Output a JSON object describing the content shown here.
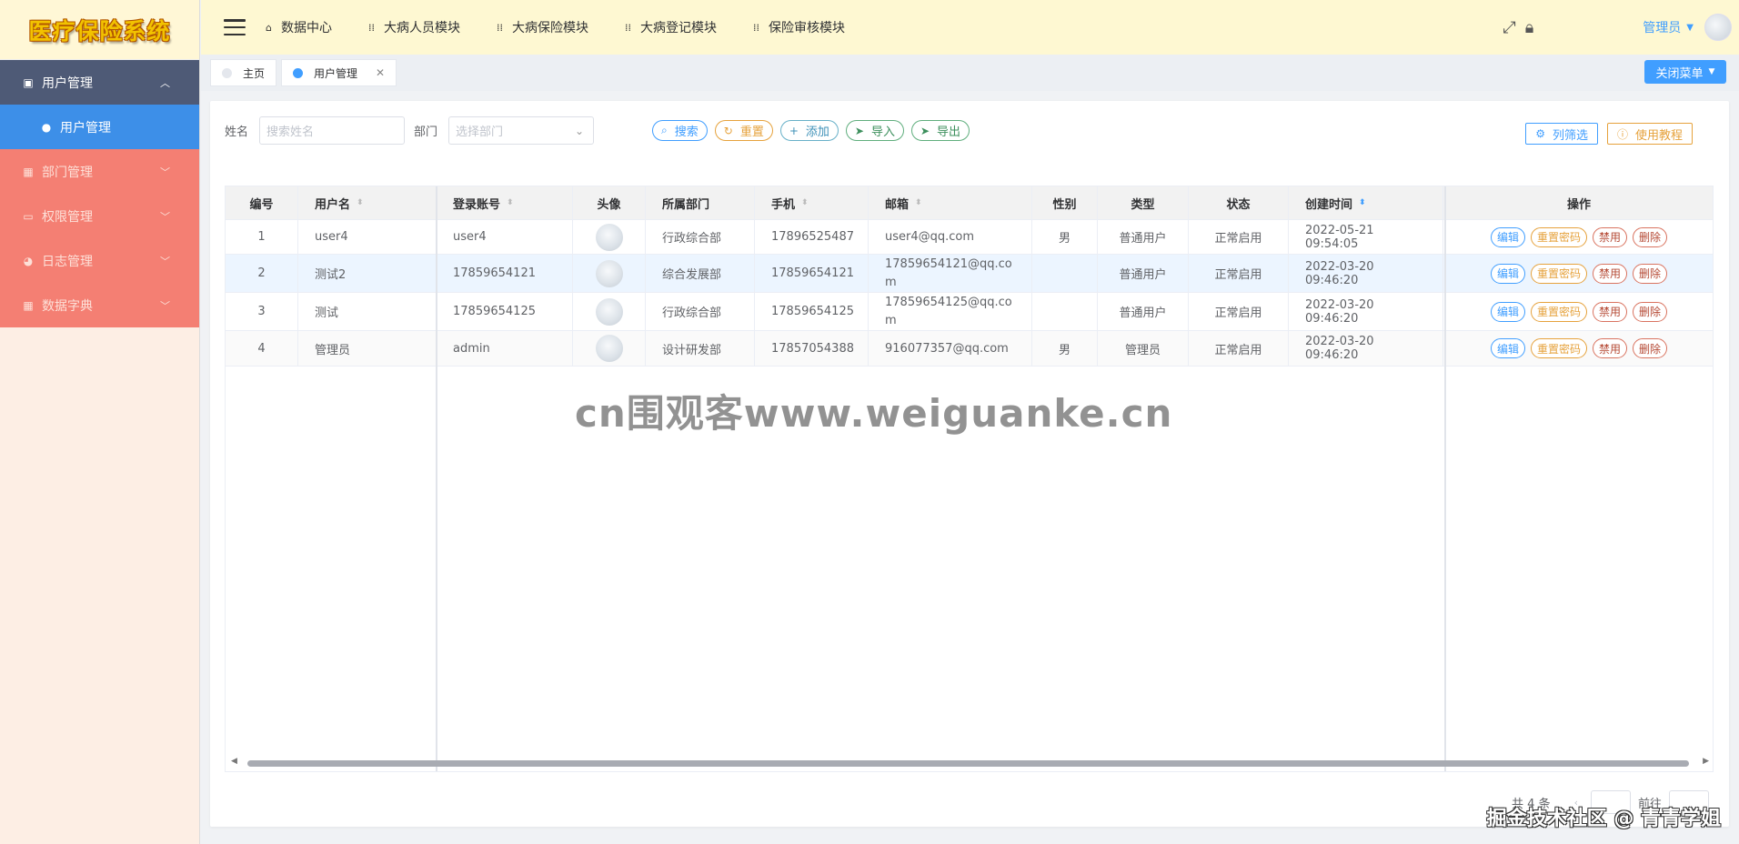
{
  "app": {
    "logo_text": "医疗保险系统"
  },
  "sidebar": {
    "items": [
      {
        "label": "用户管理",
        "icon": "user-card-icon",
        "state": "open"
      },
      {
        "label": "用户管理",
        "icon": "person-icon",
        "state": "active-sub"
      },
      {
        "label": "部门管理",
        "icon": "grid-icon",
        "state": "collapsed"
      },
      {
        "label": "权限管理",
        "icon": "monitor-icon",
        "state": "collapsed"
      },
      {
        "label": "日志管理",
        "icon": "pie-icon",
        "state": "collapsed"
      },
      {
        "label": "数据字典",
        "icon": "grid-icon",
        "state": "collapsed"
      }
    ]
  },
  "topnav": {
    "items": [
      {
        "label": "数据中心",
        "icon": "home-icon"
      },
      {
        "label": "大病人员模块",
        "icon": "grid-icon"
      },
      {
        "label": "大病保险模块",
        "icon": "grid-icon"
      },
      {
        "label": "大病登记模块",
        "icon": "grid-icon"
      },
      {
        "label": "保险审核模块",
        "icon": "grid-icon"
      }
    ],
    "user": "管理员"
  },
  "tabs": {
    "items": [
      {
        "label": "主页",
        "active": false
      },
      {
        "label": "用户管理",
        "active": true
      }
    ],
    "close_menu": "关闭菜单"
  },
  "filters": {
    "name_label": "姓名",
    "name_placeholder": "搜索姓名",
    "dept_label": "部门",
    "dept_placeholder": "选择部门"
  },
  "toolbar": {
    "search": "搜索",
    "reset": "重置",
    "add": "添加",
    "import": "导入",
    "export": "导出",
    "column_filter": "列筛选",
    "tutorial": "使用教程"
  },
  "table": {
    "columns": [
      "编号",
      "用户名",
      "登录账号",
      "头像",
      "所属部门",
      "手机",
      "邮箱",
      "性别",
      "类型",
      "状态",
      "创建时间",
      "操作"
    ],
    "rows": [
      {
        "id": "1",
        "username": "user4",
        "account": "user4",
        "dept": "行政综合部",
        "phone": "17896525487",
        "email": "user4@qq.com",
        "gender": "男",
        "type": "普通用户",
        "status": "正常启用",
        "created": "2022-05-21 09:54:05"
      },
      {
        "id": "2",
        "username": "测试2",
        "account": "17859654121",
        "dept": "综合发展部",
        "phone": "17859654121",
        "email": "17859654121@qq.com",
        "gender": "",
        "type": "普通用户",
        "status": "正常启用",
        "created": "2022-03-20 09:46:20"
      },
      {
        "id": "3",
        "username": "测试",
        "account": "17859654125",
        "dept": "行政综合部",
        "phone": "17859654125",
        "email": "17859654125@qq.com",
        "gender": "",
        "type": "普通用户",
        "status": "正常启用",
        "created": "2022-03-20 09:46:20"
      },
      {
        "id": "4",
        "username": "管理员",
        "account": "admin",
        "dept": "设计研发部",
        "phone": "17857054388",
        "email": "916077357@qq.com",
        "gender": "男",
        "type": "管理员",
        "status": "正常启用",
        "created": "2022-03-20 09:46:20"
      }
    ],
    "ops": {
      "edit": "编辑",
      "reset_pwd": "重置密码",
      "disable": "禁用",
      "delete": "删除"
    }
  },
  "pagination": {
    "total": "共 4 条",
    "goto": "前往"
  },
  "watermarks": {
    "center": "cn围观客www.weiguanke.cn",
    "corner": "掘金技术社区 @ 青青学姐"
  },
  "colors": {
    "primary": "#409eff",
    "warning": "#e6a23c",
    "success": "#4fa770",
    "sidebar_active": "#4e5a76",
    "sidebar_coral": "#f47f73",
    "topbar": "#fef8d2"
  }
}
